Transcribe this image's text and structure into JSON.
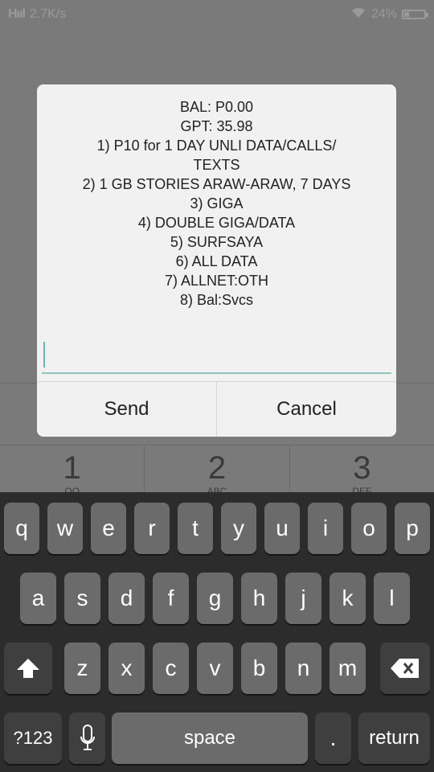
{
  "status": {
    "signal": "Hııl",
    "speed": "2.7K/s",
    "battery": "24%"
  },
  "dialer": {
    "keys": [
      {
        "num": "1",
        "sub": "OO"
      },
      {
        "num": "2",
        "sub": "ABC"
      },
      {
        "num": "3",
        "sub": "DEF"
      }
    ]
  },
  "dialog": {
    "lines": [
      "BAL: P0.00",
      "GPT: 35.98",
      "1) P10 for 1 DAY UNLI DATA/CALLS/",
      "TEXTS",
      "2) 1 GB STORIES ARAW-ARAW, 7 DAYS",
      "3) GIGA",
      "4) DOUBLE GIGA/DATA",
      "5) SURFSAYA",
      "6) ALL DATA",
      "7) ALLNET:OTH",
      "8) Bal:Svcs"
    ],
    "input_value": "",
    "send_label": "Send",
    "cancel_label": "Cancel"
  },
  "keyboard": {
    "row1": [
      "q",
      "w",
      "e",
      "r",
      "t",
      "y",
      "u",
      "i",
      "o",
      "p"
    ],
    "row2": [
      "a",
      "s",
      "d",
      "f",
      "g",
      "h",
      "j",
      "k",
      "l"
    ],
    "row3": [
      "z",
      "x",
      "c",
      "v",
      "b",
      "n",
      "m"
    ],
    "numbers_label": "?123",
    "space_label": "space",
    "period_label": ".",
    "return_label": "return"
  },
  "icons": {
    "wifi": "wifi-icon",
    "battery": "battery-icon",
    "shift": "shift-icon",
    "backspace": "backspace-icon",
    "mic": "microphone-icon"
  }
}
